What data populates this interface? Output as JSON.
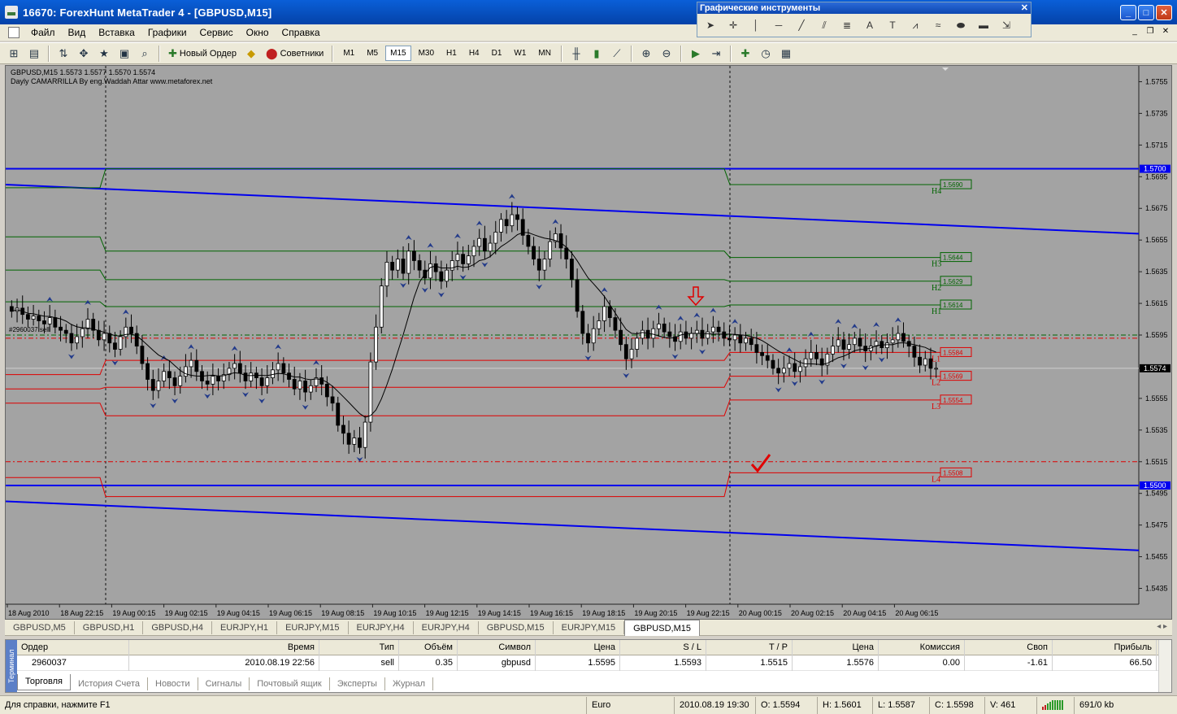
{
  "window": {
    "title": "16670: ForexHunt MetaTrader 4 - [GBPUSD,M15]"
  },
  "menu": [
    "Файл",
    "Вид",
    "Вставка",
    "Графики",
    "Сервис",
    "Окно",
    "Справка"
  ],
  "toolbar": {
    "new_order": "Новый Ордер",
    "experts": "Советники",
    "timeframes": [
      "M1",
      "M5",
      "M15",
      "M30",
      "H1",
      "H4",
      "D1",
      "W1",
      "MN"
    ],
    "active_timeframe": "M15"
  },
  "graphic_tools": {
    "title": "Графические инструменты"
  },
  "chart": {
    "header_line1": "GBPUSD,M15  1.5573 1.5577 1.5570 1.5574",
    "header_line2": "Dayly CAMARRILLA By eng.Waddah Attar www.metaforex.net",
    "order_label": "#2960037 sell",
    "price_ticks": [
      "1.5755",
      "1.5735",
      "1.5715",
      "1.5695",
      "1.5675",
      "1.5655",
      "1.5635",
      "1.5615",
      "1.5595",
      "1.5574",
      "1.5555",
      "1.5535",
      "1.5515",
      "1.5495",
      "1.5475",
      "1.5455",
      "1.5435"
    ],
    "highlight_prices": {
      "upper": "1.5700",
      "lower": "1.5500",
      "current": "1.5574"
    },
    "levels": [
      {
        "name": "H4",
        "value": "1.5690"
      },
      {
        "name": "H3",
        "value": "1.5644"
      },
      {
        "name": "H2",
        "value": "1.5629"
      },
      {
        "name": "H1",
        "value": "1.5614"
      },
      {
        "name": "L1",
        "value": "1.5584"
      },
      {
        "name": "L2",
        "value": "1.5569"
      },
      {
        "name": "L3",
        "value": "1.5554"
      },
      {
        "name": "L4",
        "value": "1.5508"
      }
    ],
    "time_ticks": [
      "18 Aug 2010",
      "18 Aug 22:15",
      "19 Aug 00:15",
      "19 Aug 02:15",
      "19 Aug 04:15",
      "19 Aug 06:15",
      "19 Aug 08:15",
      "19 Aug 10:15",
      "19 Aug 12:15",
      "19 Aug 14:15",
      "19 Aug 16:15",
      "19 Aug 18:15",
      "19 Aug 20:15",
      "19 Aug 22:15",
      "20 Aug 00:15",
      "20 Aug 02:15",
      "20 Aug 04:15",
      "20 Aug 06:15"
    ],
    "colors": {
      "bg": "#a3a3a3",
      "support": "#0000ee",
      "green": "#006400",
      "red": "#e00000"
    }
  },
  "chart_data": {
    "type": "candlestick",
    "ylim": [
      1.5425,
      1.5765
    ],
    "n": 190,
    "closes": [
      1.561,
      1.5612,
      1.5608,
      1.5605,
      1.5607,
      1.5604,
      1.5602,
      1.5606,
      1.56,
      1.5598,
      1.5596,
      1.559,
      1.5594,
      1.5599,
      1.5605,
      1.5598,
      1.5592,
      1.5596,
      1.559,
      1.5586,
      1.5594,
      1.56,
      1.5596,
      1.5588,
      1.5577,
      1.5567,
      1.556,
      1.5566,
      1.5572,
      1.5568,
      1.5563,
      1.5569,
      1.5575,
      1.5579,
      1.5572,
      1.5566,
      1.5564,
      1.5569,
      1.5566,
      1.557,
      1.5574,
      1.5577,
      1.5571,
      1.5566,
      1.5571,
      1.5568,
      1.5563,
      1.5568,
      1.5573,
      1.5577,
      1.5571,
      1.5567,
      1.5561,
      1.5566,
      1.5559,
      1.5563,
      1.5568,
      1.5564,
      1.5556,
      1.5552,
      1.5538,
      1.5533,
      1.5526,
      1.553,
      1.5524,
      1.554,
      1.5578,
      1.56,
      1.5626,
      1.5641,
      1.5636,
      1.5643,
      1.5634,
      1.5648,
      1.5642,
      1.5636,
      1.5631,
      1.564,
      1.5635,
      1.5629,
      1.5636,
      1.5642,
      1.5646,
      1.564,
      1.5645,
      1.5651,
      1.5656,
      1.5648,
      1.5653,
      1.566,
      1.5668,
      1.5664,
      1.5671,
      1.5668,
      1.5658,
      1.5651,
      1.5643,
      1.5636,
      1.5643,
      1.5654,
      1.5659,
      1.565,
      1.5643,
      1.563,
      1.561,
      1.5596,
      1.559,
      1.5599,
      1.5604,
      1.5613,
      1.5606,
      1.5598,
      1.5589,
      1.558,
      1.5586,
      1.5593,
      1.5598,
      1.5593,
      1.5599,
      1.5602,
      1.5597,
      1.5594,
      1.5591,
      1.5597,
      1.5593,
      1.5596,
      1.5598,
      1.5593,
      1.5597,
      1.56,
      1.5597,
      1.5593,
      1.5592,
      1.5595,
      1.559,
      1.5593,
      1.5589,
      1.5584,
      1.5582,
      1.5579,
      1.5574,
      1.5571,
      1.5574,
      1.5577,
      1.5572,
      1.5575,
      1.558,
      1.5584,
      1.558,
      1.5576,
      1.5583,
      1.5588,
      1.5592,
      1.5586,
      1.5589,
      1.5593,
      1.5588,
      1.5585,
      1.5588,
      1.5591,
      1.5587,
      1.559,
      1.5592,
      1.5596,
      1.5591,
      1.5588,
      1.5581,
      1.5576,
      1.558,
      1.5574,
      1.5574
    ],
    "dates": [
      "18 Aug 2010",
      "20 Aug 06:15"
    ]
  },
  "symbol_tabs": [
    "GBPUSD,M5",
    "GBPUSD,H1",
    "GBPUSD,H4",
    "EURJPY,H1",
    "EURJPY,M15",
    "EURJPY,H4",
    "EURJPY,H4",
    "GBPUSD,M15",
    "EURJPY,M15",
    "GBPUSD,M15"
  ],
  "active_symbol_tab": 9,
  "terminal": {
    "side_label": "Терминал",
    "columns": [
      "Ордер",
      "Время",
      "Тип",
      "Объём",
      "Символ",
      "Цена",
      "S / L",
      "T / P",
      "Цена",
      "Комиссия",
      "Своп",
      "Прибыль"
    ],
    "rows": [
      [
        "2960037",
        "2010.08.19 22:56",
        "sell",
        "0.35",
        "gbpusd",
        "1.5595",
        "1.5593",
        "1.5515",
        "1.5576",
        "0.00",
        "-1.61",
        "66.50"
      ]
    ],
    "tabs": [
      "Торговля",
      "История Счета",
      "Новости",
      "Сигналы",
      "Почтовый ящик",
      "Эксперты",
      "Журнал"
    ],
    "active_tab": 0
  },
  "status": {
    "help": "Для справки, нажмите F1",
    "profile": "Euro",
    "datetime": "2010.08.19 19:30",
    "open": "O: 1.5594",
    "high": "H: 1.5601",
    "low": "L: 1.5587",
    "close": "C: 1.5598",
    "volume": "V: 461",
    "traffic": "691/0 kb"
  }
}
